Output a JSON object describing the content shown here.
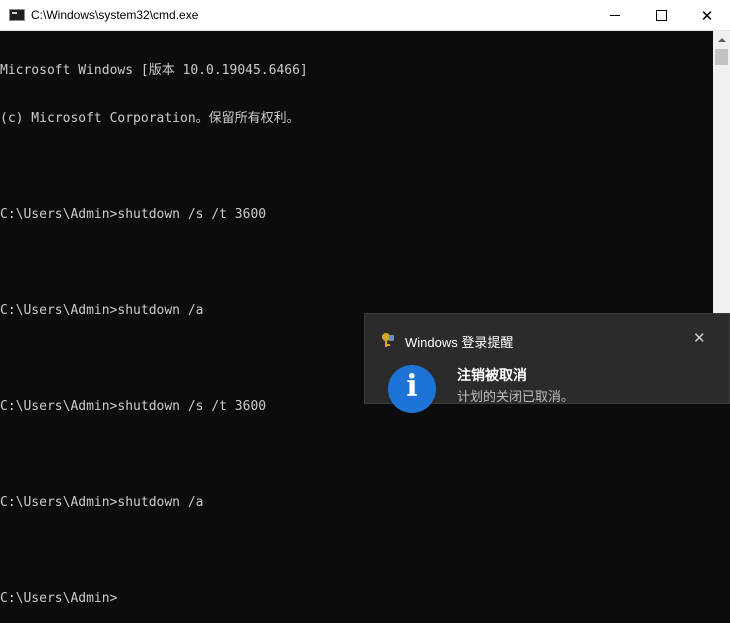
{
  "window": {
    "title": "C:\\Windows\\system32\\cmd.exe"
  },
  "console": {
    "lines": [
      "Microsoft Windows [版本 10.0.19045.6466]",
      "(c) Microsoft Corporation。保留所有权利。",
      "",
      "C:\\Users\\Admin>shutdown /s /t 3600",
      "",
      "C:\\Users\\Admin>shutdown /a",
      "",
      "C:\\Users\\Admin>shutdown /s /t 3600",
      "",
      "C:\\Users\\Admin>shutdown /a",
      "",
      "C:\\Users\\Admin>"
    ]
  },
  "toast": {
    "app_name": "Windows 登录提醒",
    "title": "注销被取消",
    "body": "计划的关闭已取消。",
    "close_glyph": "✕",
    "info_glyph": "i",
    "accent": "#1e73d6"
  },
  "controls": {
    "close_glyph": "✕"
  }
}
